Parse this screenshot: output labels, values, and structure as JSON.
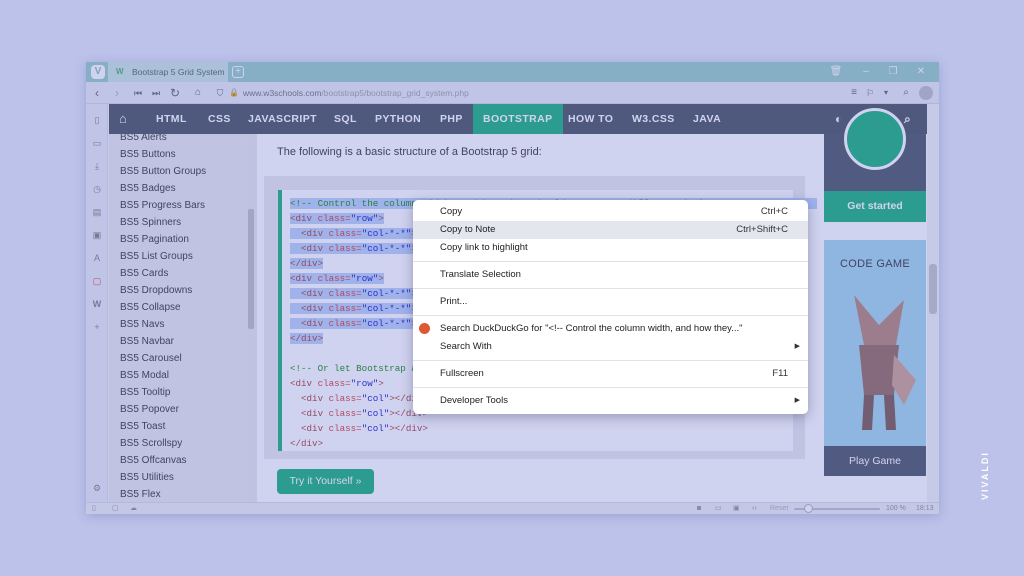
{
  "browser": {
    "tab_title": "Bootstrap 5 Grid System",
    "tab_favicon": "W",
    "url_host": "www.w3schools.com",
    "url_path": "/bootstrap5/bootstrap_grid_system.php",
    "status": {
      "reset": "Reset",
      "zoom": "100 %",
      "time": "18:13"
    },
    "brand": "VIVALDI"
  },
  "topnav": {
    "items": [
      "HTML",
      "CSS",
      "JAVASCRIPT",
      "SQL",
      "PYTHON",
      "PHP",
      "BOOTSTRAP",
      "HOW TO",
      "W3.CSS",
      "JAVA"
    ],
    "active": "BOOTSTRAP"
  },
  "sidebar": {
    "items": [
      "BS5 Alerts",
      "BS5 Buttons",
      "BS5 Button Groups",
      "BS5 Badges",
      "BS5 Progress Bars",
      "BS5 Spinners",
      "BS5 Pagination",
      "BS5 List Groups",
      "BS5 Cards",
      "BS5 Dropdowns",
      "BS5 Collapse",
      "BS5 Navs",
      "BS5 Navbar",
      "BS5 Carousel",
      "BS5 Modal",
      "BS5 Tooltip",
      "BS5 Popover",
      "BS5 Toast",
      "BS5 Scrollspy",
      "BS5 Offcanvas",
      "BS5 Utilities",
      "BS5 Flex"
    ]
  },
  "content": {
    "intro": "The following is a basic structure of a Bootstrap 5 grid:",
    "try_button": "Try it Yourself »"
  },
  "ads": {
    "get_started": "Get started",
    "code_game": "CODE GAME",
    "play_game": "Play Game"
  },
  "context_menu": {
    "copy": "Copy",
    "copy_sc": "Ctrl+C",
    "copy_note": "Copy to Note",
    "copy_note_sc": "Ctrl+Shift+C",
    "copy_link": "Copy link to highlight",
    "translate": "Translate Selection",
    "print": "Print...",
    "search_ddg": "Search DuckDuckGo for \"<!-- Control the column width, and how they...\"",
    "search_with": "Search With",
    "fullscreen": "Fullscreen",
    "fullscreen_sc": "F11",
    "devtools": "Developer Tools"
  },
  "colors": {
    "accent": "#04aa6d",
    "nav": "#3a4452",
    "background": "#bcc2ea"
  }
}
